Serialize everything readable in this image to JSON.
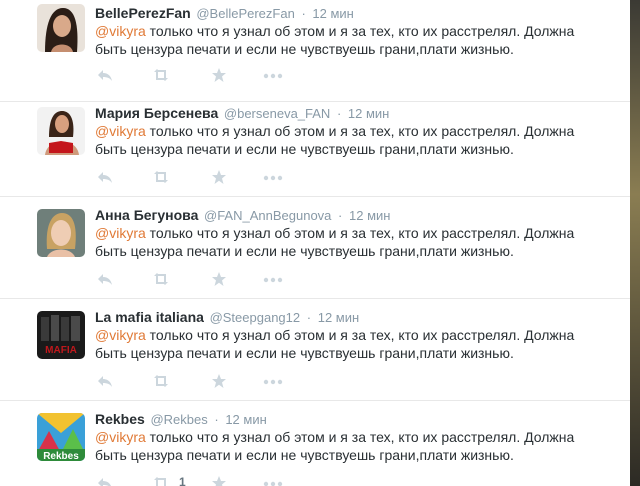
{
  "colors": {
    "mention": "#e07a37",
    "meta": "#8899a6",
    "icon": "#ccd6dd"
  },
  "tweets": [
    {
      "name": "BellePerezFan",
      "handle": "@BellePerezFan",
      "time": "12 мин",
      "mention": "@vikyra",
      "line1": " только что я узнал об этом и я за тех, кто их расстрелял. Должна",
      "line2": "быть цензура печати и если не чувствуешь грани,плати жизнью.",
      "avatar_icon": "woman-dark-hair-avatar"
    },
    {
      "name": "Мария Берсенева",
      "handle": "@berseneva_FAN",
      "time": "12 мин",
      "mention": "@vikyra",
      "line1": " только что я узнал об этом и я за тех, кто их расстрелял. Должна",
      "line2": "быть цензура печати и если не чувствуешь грани,плати жизнью.",
      "avatar_icon": "woman-red-top-avatar"
    },
    {
      "name": "Анна Бегунова",
      "handle": "@FAN_AnnBegunova",
      "time": "12 мин",
      "mention": "@vikyra",
      "line1": " только что я узнал об этом и я за тех, кто их расстрелял. Должна",
      "line2": "быть цензура печати и если не чувствуешь грани,плати жизнью.",
      "avatar_icon": "woman-blonde-avatar"
    },
    {
      "name": "La mafia italiana",
      "handle": "@Steepgang12",
      "time": "12 мин",
      "mention": "@vikyra",
      "line1": " только что я узнал об этом и я за тех, кто их расстрелял. Должна",
      "line2": "быть цензура печати и если не чувствуешь грани,плати жизнью.",
      "avatar_icon": "mafia-poster-avatar",
      "avatar_text": "MAFIA"
    },
    {
      "name": "Rekbes",
      "handle": "@Rekbes",
      "time": "12 мин",
      "mention": "@vikyra",
      "line1": " только что я узнал об этом и я за тех, кто их расстрелял. Должна",
      "line2": "быть цензура печати и если не чувствуешь грани,плати жизнью.",
      "avatar_icon": "rekbes-logo-avatar",
      "avatar_text": "Rekbes",
      "retweet_count": "1"
    }
  ]
}
